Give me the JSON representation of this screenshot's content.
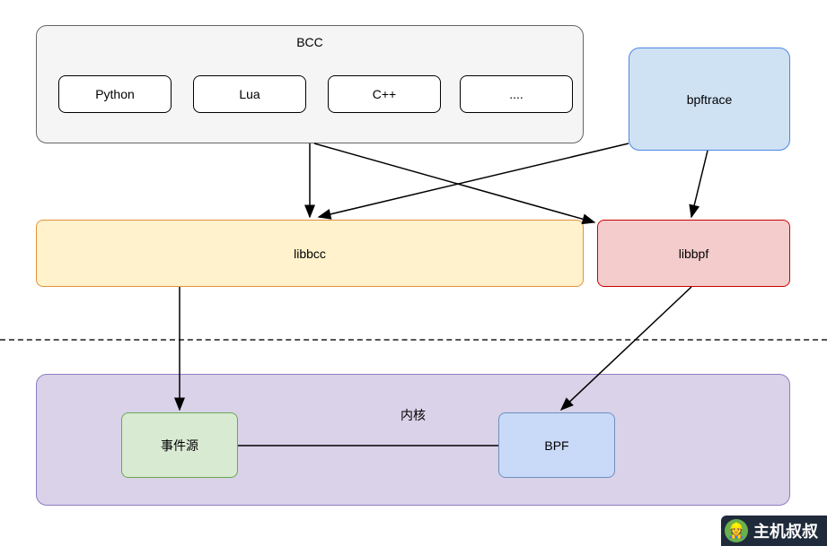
{
  "bcc": {
    "title": "BCC",
    "items": [
      "Python",
      "Lua",
      "C++",
      "...."
    ]
  },
  "bpftrace": "bpftrace",
  "libbcc": "libbcc",
  "libbpf": "libbpf",
  "kernel": {
    "title": "内核",
    "event_source": "事件源",
    "bpf": "BPF"
  },
  "logo": "主机叔叔"
}
